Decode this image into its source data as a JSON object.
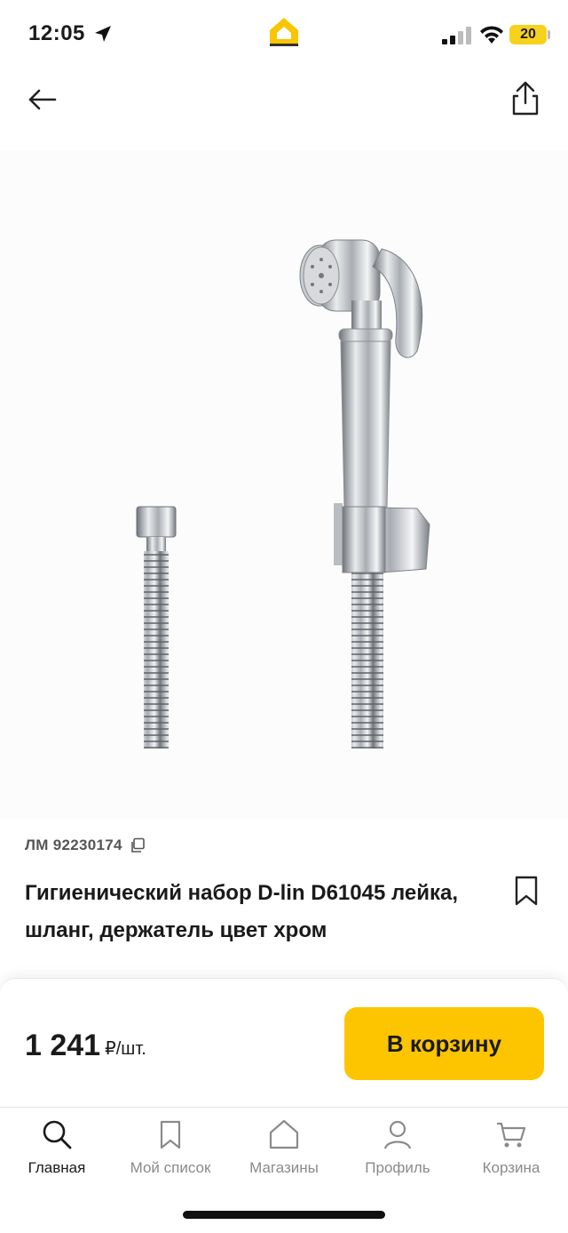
{
  "status_bar": {
    "time": "12:05",
    "battery": "20",
    "icons": [
      "location-arrow-icon",
      "signal-icon",
      "wifi-icon",
      "battery-icon"
    ]
  },
  "header": {
    "back_icon": "arrow-left-icon",
    "share_icon": "share-icon"
  },
  "product": {
    "image_alt": "product-photo",
    "article": "ЛМ 92230174",
    "title": "Гигиенический набор D-lin D61045 лейка, шланг, держатель цвет хром",
    "bookmark_icon": "bookmark-icon"
  },
  "purchase": {
    "price": "1 241",
    "unit": "₽/шт.",
    "cart_button": "В корзину",
    "accent_color": "#fdc500"
  },
  "tabs": [
    {
      "label": "Главная",
      "icon": "search-icon",
      "active": true
    },
    {
      "label": "Мой список",
      "icon": "bookmark-icon",
      "active": false
    },
    {
      "label": "Магазины",
      "icon": "store-icon",
      "active": false
    },
    {
      "label": "Профиль",
      "icon": "profile-icon",
      "active": false
    },
    {
      "label": "Корзина",
      "icon": "cart-icon",
      "active": false
    }
  ]
}
